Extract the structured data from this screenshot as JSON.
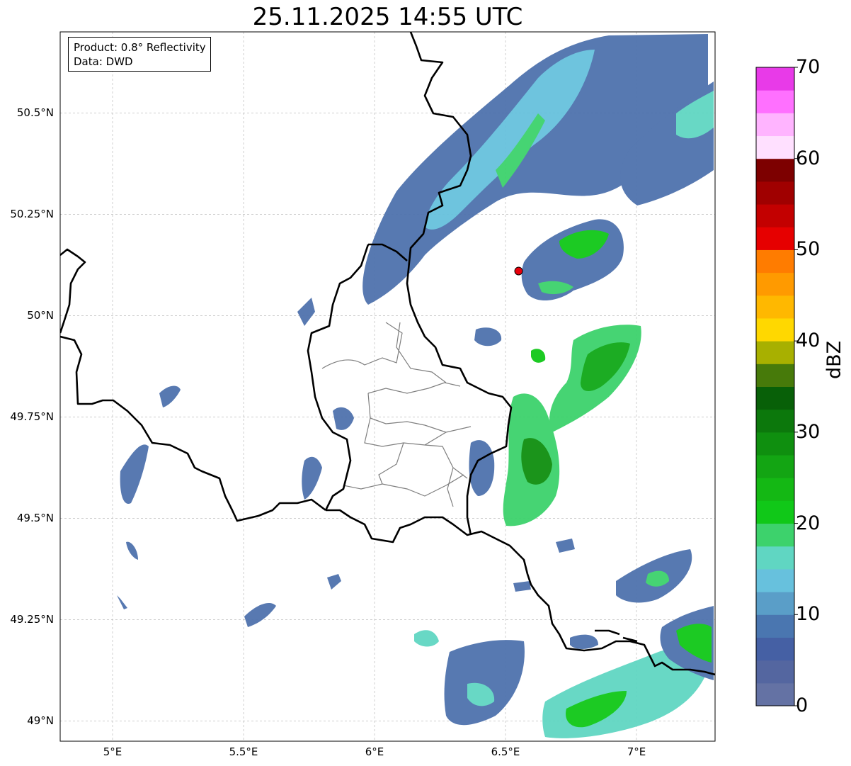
{
  "title": "25.11.2025 14:55 UTC",
  "info_box": {
    "product": "Product: 0.8° Reflectivity",
    "source": "Data: DWD"
  },
  "map": {
    "extent": {
      "lon": [
        4.8,
        7.3
      ],
      "lat": [
        48.95,
        50.7
      ]
    },
    "lat_ticks": [
      {
        "value": 50.5,
        "label": "50.5°N"
      },
      {
        "value": 50.25,
        "label": "50.25°N"
      },
      {
        "value": 50.0,
        "label": "50°N"
      },
      {
        "value": 49.75,
        "label": "49.75°N"
      },
      {
        "value": 49.5,
        "label": "49.5°N"
      },
      {
        "value": 49.25,
        "label": "49.25°N"
      },
      {
        "value": 49.0,
        "label": "49°N"
      }
    ],
    "lon_ticks": [
      {
        "value": 5.0,
        "label": "5°E"
      },
      {
        "value": 5.5,
        "label": "5.5°E"
      },
      {
        "value": 6.0,
        "label": "6°E"
      },
      {
        "value": 6.5,
        "label": "6.5°E"
      },
      {
        "value": 7.0,
        "label": "7°E"
      }
    ],
    "gridlines": true,
    "radar_site": {
      "lon": 6.55,
      "lat": 50.11,
      "color": "#e8000b"
    }
  },
  "colorbar": {
    "label": "dBZ",
    "min": 0,
    "max": 70,
    "tick_labels": [
      "0",
      "10",
      "20",
      "30",
      "40",
      "50",
      "60",
      "70"
    ],
    "colors": [
      "#6472a4",
      "#5466a0",
      "#4560a4",
      "#4a76b0",
      "#5a9ec8",
      "#67c1dd",
      "#60d6c2",
      "#3dd26c",
      "#10c818",
      "#14b814",
      "#13a513",
      "#0f8f0f",
      "#0c780c",
      "#086008",
      "#477a0a",
      "#a8b000",
      "#ffd800",
      "#ffb800",
      "#ff9a00",
      "#ff7c00",
      "#e60000",
      "#c30000",
      "#a00000",
      "#7d0000",
      "#ffe0ff",
      "#ffb4ff",
      "#ff70ff",
      "#e83ae8"
    ]
  }
}
